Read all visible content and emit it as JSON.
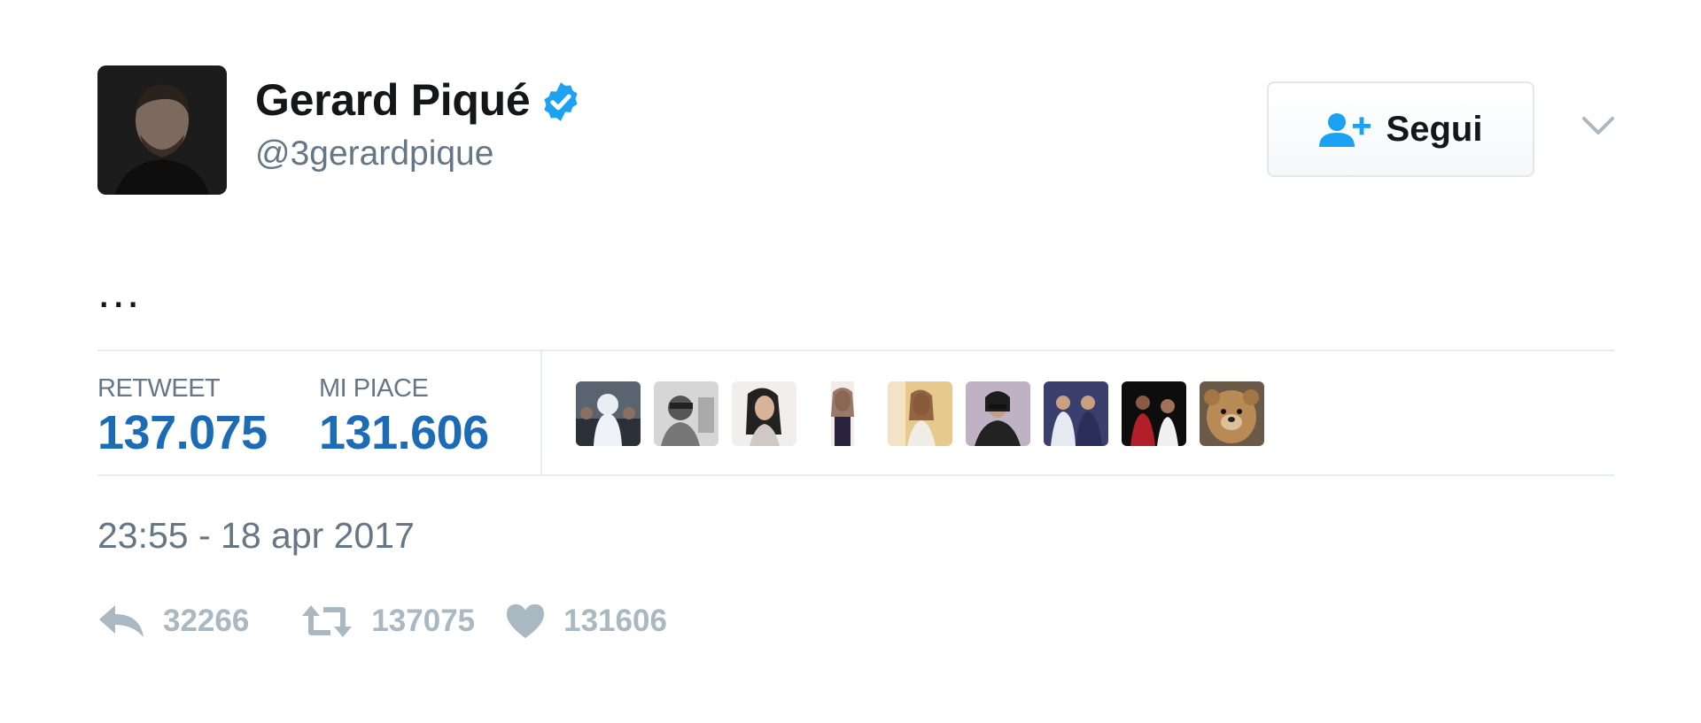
{
  "user": {
    "name": "Gerard Piqué",
    "handle": "@3gerardpique",
    "verified": true,
    "follow_label": "Segui"
  },
  "tweet": {
    "text": "...",
    "timestamp": "23:55 - 18 apr 2017"
  },
  "stats": {
    "retweet_label": "RETWEET",
    "retweet_value": "137.075",
    "like_label": "MI PIACE",
    "like_value": "131.606"
  },
  "actions": {
    "reply_count": "32266",
    "retweet_count": "137075",
    "like_count": "131606"
  },
  "colors": {
    "accent": "#1da1f2",
    "stat_value": "#1b6bb5",
    "muted": "#657786",
    "action_gray": "#aab8c2"
  },
  "icons": {
    "verified": "verified-badge-icon",
    "follow": "person-add-icon",
    "caret": "chevron-down-icon",
    "reply": "reply-icon",
    "retweet": "retweet-icon",
    "like": "heart-icon"
  }
}
